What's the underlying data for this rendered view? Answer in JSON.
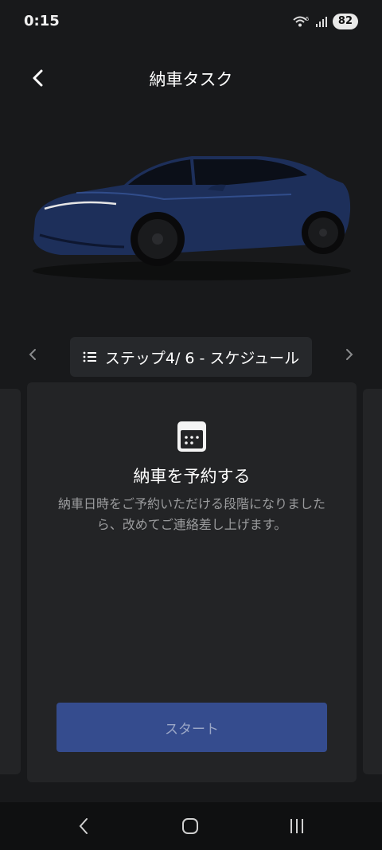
{
  "status_bar": {
    "time": "0:15",
    "battery": "82",
    "network": "5"
  },
  "header": {
    "title": "納車タスク"
  },
  "step_nav": {
    "label": "ステップ4/ 6 - スケジュール"
  },
  "card": {
    "title": "納車を予約する",
    "description": "納車日時をご予約いただける段階になりましたら、改めてご連絡差し上げます。",
    "start_button": "スタート"
  },
  "colors": {
    "background": "#18191b",
    "card": "#232426",
    "button": "#354c8e",
    "car_body": "#1d2f5a"
  },
  "icons": {
    "back": "chevron-left-icon",
    "list": "list-icon",
    "calendar": "calendar-icon",
    "step_prev": "chevron-left-icon",
    "step_next": "chevron-right-icon"
  }
}
